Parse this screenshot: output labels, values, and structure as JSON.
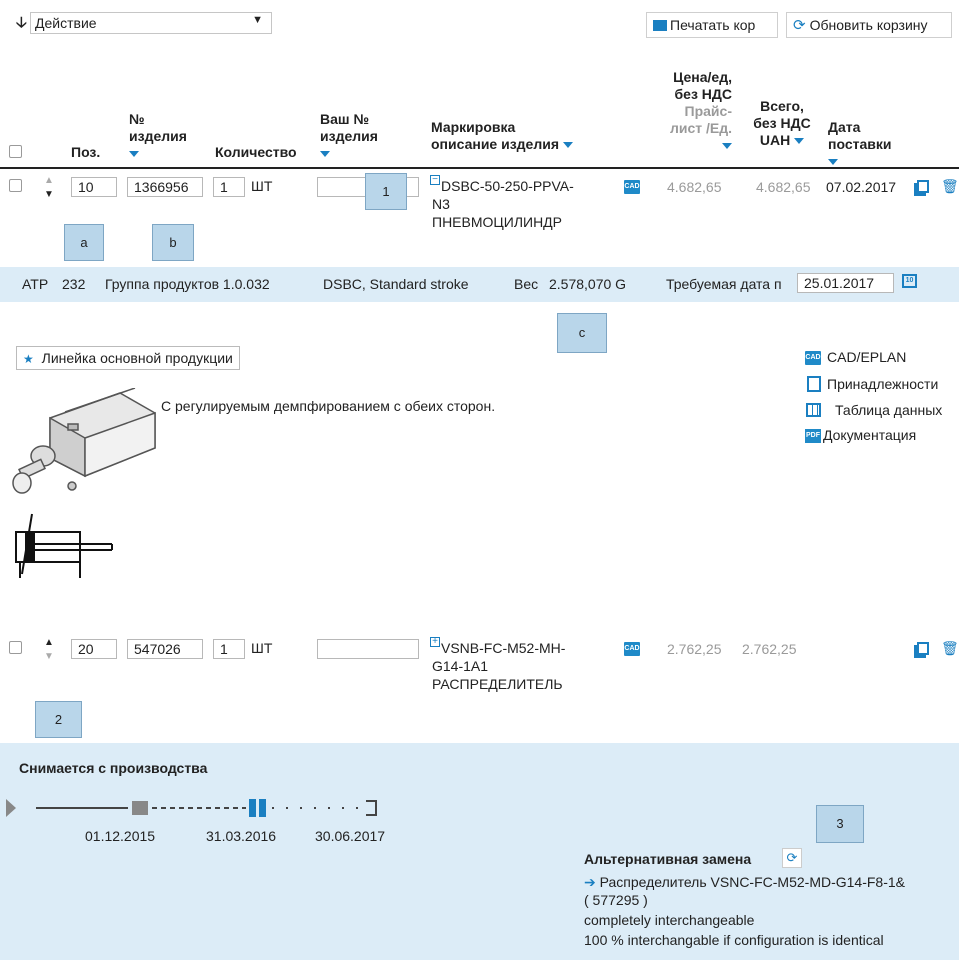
{
  "toolbar": {
    "action_select": "Действие",
    "print_button": "Печатать кор",
    "refresh_button": "Обновить корзину"
  },
  "headers": {
    "pos": "Поз.",
    "item_no_1": "№",
    "item_no_2": "изделия",
    "quantity": "Количество",
    "your_no_1": "Ваш №",
    "your_no_2": "изделия",
    "marking_1": "Маркировка",
    "marking_2": "описание изделия",
    "price_1": "Цена/ед,",
    "price_2": "без НДС",
    "price_3": "Прайс-",
    "price_4": "лист /Ед.",
    "total_1": "Всего,",
    "total_2": "без НДС",
    "total_3": "UAH",
    "date_1": "Дата",
    "date_2": "поставки"
  },
  "row1": {
    "pos": "10",
    "item_no": "1366956",
    "qty": "1",
    "unit": "ШТ",
    "your_no": "",
    "desc_line1": "DSBC-50-250-PPVA-",
    "desc_line2": "N3",
    "desc_line3": "ПНЕВМОЦИЛИНДР",
    "price": "4.682,65",
    "total": "4.682,65",
    "date": "07.02.2017"
  },
  "details": {
    "atp": "ATP",
    "atp_value": "232",
    "group": "Группа продуктов 1.0.032",
    "series": "DSBC, Standard stroke",
    "weight_label": "Вес",
    "weight_value": "2.578,070 G",
    "req_date_label": "Требуемая дата п",
    "req_date_value": "25.01.2017",
    "core_badge": "Линейка основной продукции",
    "description": "С регулируемым демпфированием с обеих сторон.",
    "links": [
      "CAD/EPLAN",
      "Принадлежности",
      "Таблица данных",
      "Документация"
    ]
  },
  "row2": {
    "pos": "20",
    "item_no": "547026",
    "qty": "1",
    "unit": "ШТ",
    "your_no": "",
    "desc_line1": "VSNB-FC-M52-MH-",
    "desc_line2": "G14-1A1",
    "desc_line3": "РАСПРЕДЕЛИТЕЛЬ",
    "price": "2.762,25",
    "total": "2.762,25"
  },
  "discontinued": {
    "title": "Снимается с производства",
    "dates": [
      "01.12.2015",
      "31.03.2016",
      "30.06.2017"
    ],
    "alt_title": "Альтернативная замена",
    "alt_link": "Распределитель VSNC-FC-M52-MD-G14-F8-1&",
    "alt_code": "( 577295 )",
    "alt_note1": "completely interchangeable",
    "alt_note2": "100 % interchangable if configuration is identical"
  },
  "callouts": {
    "c1": "1",
    "a": "a",
    "b": "b",
    "c": "c",
    "c2": "2",
    "c3": "3"
  },
  "colors": {
    "accent": "#1a7fc1",
    "band": "#dcecf7",
    "callout": "#b9d6ea"
  }
}
